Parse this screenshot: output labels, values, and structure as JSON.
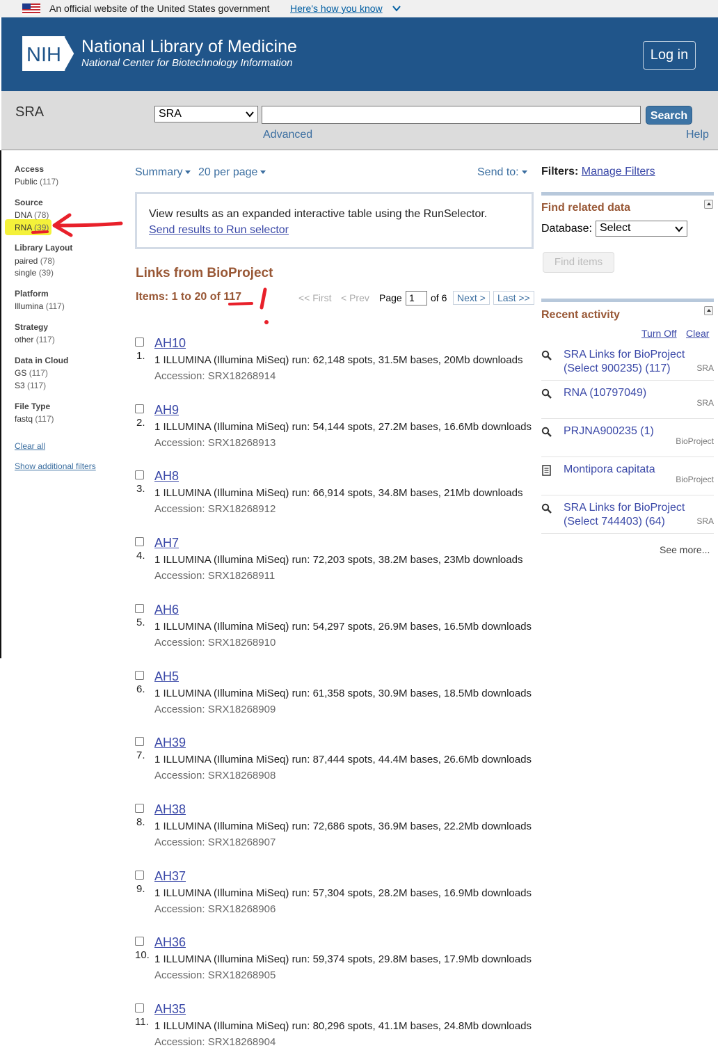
{
  "gov_banner": {
    "text": "An official website of the United States government",
    "link": "Here's how you know"
  },
  "header": {
    "title": "National Library of Medicine",
    "subtitle": "National Center for Biotechnology Information",
    "logo_text": "NIH",
    "login_label": "Log in",
    "brand_color": "#20558a"
  },
  "search": {
    "db_title": "SRA",
    "db_selected": "SRA",
    "term_value": "",
    "button_label": "Search",
    "advanced_label": "Advanced",
    "help_label": "Help"
  },
  "sidebar": {
    "groups": [
      {
        "title": "Access",
        "items": [
          {
            "label": "Public",
            "count": "(117)"
          }
        ]
      },
      {
        "title": "Source",
        "items": [
          {
            "label": "DNA",
            "count": "(78)"
          },
          {
            "label": "RNA",
            "count": "(39)"
          }
        ]
      },
      {
        "title": "Library Layout",
        "items": [
          {
            "label": "paired",
            "count": "(78)"
          },
          {
            "label": "single",
            "count": "(39)"
          }
        ]
      },
      {
        "title": "Platform",
        "items": [
          {
            "label": "Illumina",
            "count": "(117)"
          }
        ]
      },
      {
        "title": "Strategy",
        "items": [
          {
            "label": "other",
            "count": "(117)"
          }
        ]
      },
      {
        "title": "Data in Cloud",
        "items": [
          {
            "label": "GS",
            "count": "(117)"
          },
          {
            "label": "S3",
            "count": "(117)"
          }
        ]
      },
      {
        "title": "File Type",
        "items": [
          {
            "label": "fastq",
            "count": "(117)"
          }
        ]
      }
    ],
    "clear_all": "Clear all",
    "show_additional": "Show additional filters"
  },
  "toolbar": {
    "format": "Summary",
    "per_page": "20 per page",
    "send_to": "Send to:"
  },
  "run_selector": {
    "text": "View results as an expanded interactive table using the RunSelector.",
    "link": "Send results to Run selector"
  },
  "results": {
    "heading": "Links from BioProject",
    "items_label": "Items: 1 to 20 of 117",
    "pager": {
      "first": "<< First",
      "prev": "< Prev",
      "page_label": "Page",
      "page_value": "1",
      "of_label": "of 6",
      "next": "Next >",
      "last": "Last >>"
    },
    "list": [
      {
        "num": "1.",
        "title": "AH10",
        "desc": "1 ILLUMINA (Illumina MiSeq) run: 62,148 spots, 31.5M bases, 20Mb downloads",
        "acc": "Accession: SRX18268914"
      },
      {
        "num": "2.",
        "title": "AH9",
        "desc": "1 ILLUMINA (Illumina MiSeq) run: 54,144 spots, 27.2M bases, 16.6Mb downloads",
        "acc": "Accession: SRX18268913"
      },
      {
        "num": "3.",
        "title": "AH8",
        "desc": "1 ILLUMINA (Illumina MiSeq) run: 66,914 spots, 34.8M bases, 21Mb downloads",
        "acc": "Accession: SRX18268912"
      },
      {
        "num": "4.",
        "title": "AH7",
        "desc": "1 ILLUMINA (Illumina MiSeq) run: 72,203 spots, 38.2M bases, 23Mb downloads",
        "acc": "Accession: SRX18268911"
      },
      {
        "num": "5.",
        "title": "AH6",
        "desc": "1 ILLUMINA (Illumina MiSeq) run: 54,297 spots, 26.9M bases, 16.5Mb downloads",
        "acc": "Accession: SRX18268910"
      },
      {
        "num": "6.",
        "title": "AH5",
        "desc": "1 ILLUMINA (Illumina MiSeq) run: 61,358 spots, 30.9M bases, 18.5Mb downloads",
        "acc": "Accession: SRX18268909"
      },
      {
        "num": "7.",
        "title": "AH39",
        "desc": "1 ILLUMINA (Illumina MiSeq) run: 87,444 spots, 44.4M bases, 26.6Mb downloads",
        "acc": "Accession: SRX18268908"
      },
      {
        "num": "8.",
        "title": "AH38",
        "desc": "1 ILLUMINA (Illumina MiSeq) run: 72,686 spots, 36.9M bases, 22.2Mb downloads",
        "acc": "Accession: SRX18268907"
      },
      {
        "num": "9.",
        "title": "AH37",
        "desc": "1 ILLUMINA (Illumina MiSeq) run: 57,304 spots, 28.2M bases, 16.9Mb downloads",
        "acc": "Accession: SRX18268906"
      },
      {
        "num": "10.",
        "title": "AH36",
        "desc": "1 ILLUMINA (Illumina MiSeq) run: 59,374 spots, 29.8M bases, 17.9Mb downloads",
        "acc": "Accession: SRX18268905"
      },
      {
        "num": "11.",
        "title": "AH35",
        "desc": "1 ILLUMINA (Illumina MiSeq) run: 80,296 spots, 41.1M bases, 24.8Mb downloads",
        "acc": "Accession: SRX18268904"
      }
    ]
  },
  "right": {
    "filters_label": "Filters:",
    "manage_filters": "Manage Filters",
    "find_related": "Find related data",
    "database_label": "Database:",
    "database_selected": "Select",
    "find_items": "Find items",
    "recent_activity": "Recent activity",
    "turn_off": "Turn Off",
    "clear": "Clear",
    "activity": [
      {
        "icon": "search-icon",
        "line1": "SRA Links for BioProject",
        "line2": "(Select 900235) (117)",
        "db": "SRA"
      },
      {
        "icon": "search-icon",
        "line1": "RNA (10797049)",
        "line2": "",
        "db": "SRA"
      },
      {
        "icon": "search-icon",
        "line1": "PRJNA900235 (1)",
        "line2": "",
        "db": "BioProject"
      },
      {
        "icon": "document-icon",
        "line1": "Montipora capitata",
        "line2": "",
        "db": "BioProject"
      },
      {
        "icon": "search-icon",
        "line1": "SRA Links for BioProject",
        "line2": "(Select 744403) (64)",
        "db": "SRA"
      }
    ],
    "see_more": "See more..."
  },
  "colors": {
    "accent": "#985735",
    "link": "#3b49a8",
    "highlight": "#f4f13a",
    "annotation": "#e8202a"
  }
}
